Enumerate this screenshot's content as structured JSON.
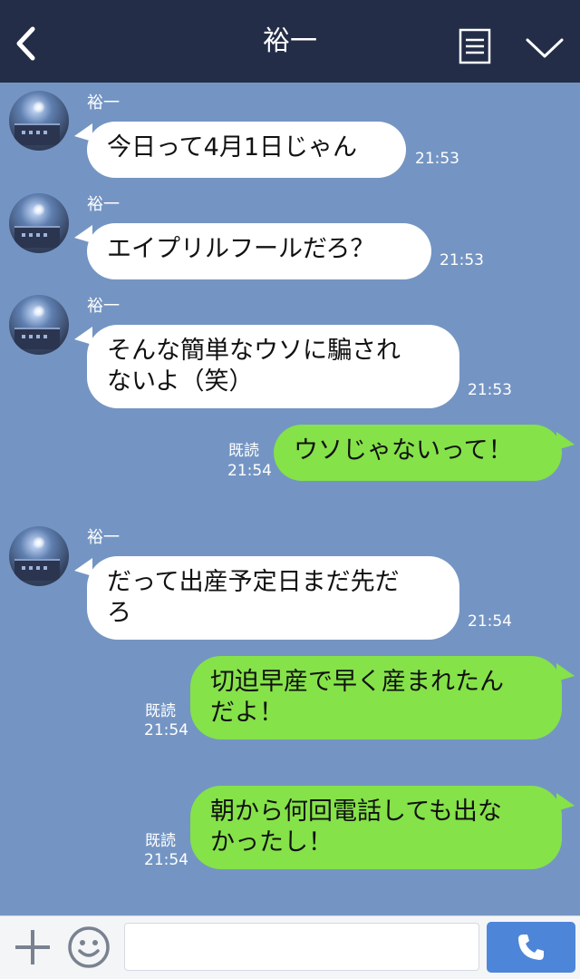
{
  "header": {
    "title": "裕一"
  },
  "messages": [
    {
      "sender": "裕一",
      "lines": [
        "今日って4月1日じゃん"
      ],
      "time": "21:53"
    },
    {
      "sender": "裕一",
      "lines": [
        "エイプリルフールだろ？"
      ],
      "time": "21:53"
    },
    {
      "sender": "裕一",
      "lines": [
        "そんな簡単なウソに騙され",
        "ないよ（笑）"
      ],
      "time": "21:53"
    },
    {
      "lines": [
        "ウソじゃないって！"
      ],
      "read": "既読",
      "time": "21:54"
    },
    {
      "sender": "裕一",
      "lines": [
        "だって出産予定日まだ先だ",
        "ろ"
      ],
      "time": "21:54"
    },
    {
      "lines": [
        "切迫早産で早く産まれたん",
        "だよ！"
      ],
      "read": "既読",
      "time": "21:54"
    },
    {
      "lines": [
        "朝から何回電話しても出な",
        "かったし！"
      ],
      "read": "既読",
      "time": "21:54"
    }
  ],
  "footer": {
    "input_value": "",
    "input_placeholder": ""
  },
  "icons": {
    "back": "chevron-left-icon",
    "menu": "menu-list-icon",
    "collapse": "chevron-down-icon",
    "add": "plus-icon",
    "emoji": "smiley-icon",
    "call": "phone-icon"
  },
  "colors": {
    "header_bg": "#232d47",
    "chat_bg": "#7495c3",
    "incoming_bubble": "#ffffff",
    "outgoing_bubble": "#85e249",
    "call_button": "#4d86d8"
  }
}
